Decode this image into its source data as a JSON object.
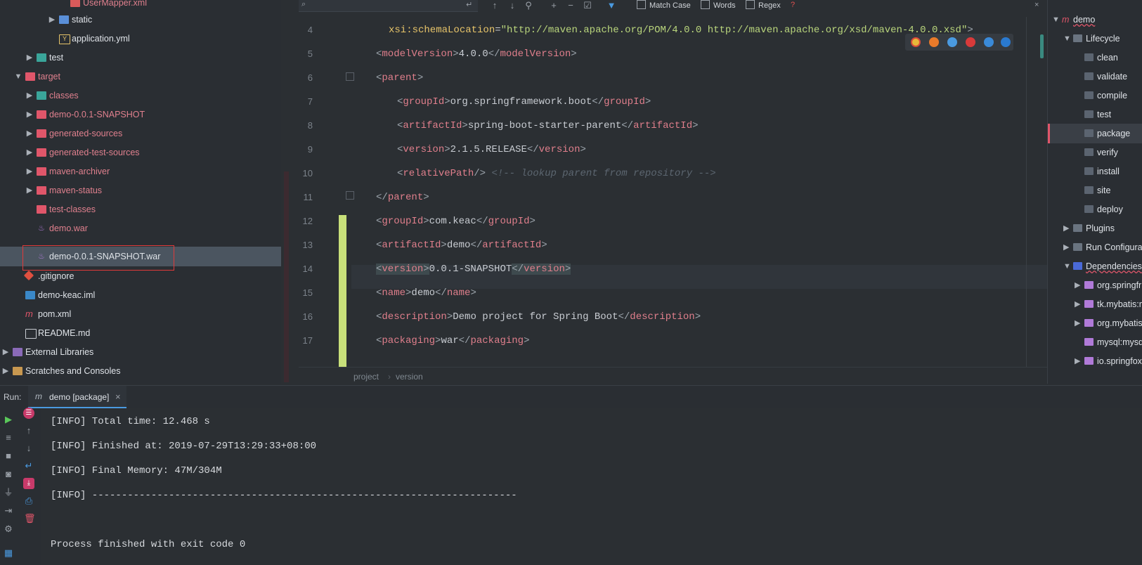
{
  "project_tree": {
    "items": [
      {
        "label": "UserMapper.xml",
        "kind": "xml"
      },
      {
        "label": "static",
        "kind": "folder"
      },
      {
        "label": "application.yml",
        "kind": "yml"
      },
      {
        "label": "test",
        "kind": "folder"
      },
      {
        "label": "target",
        "kind": "folder"
      },
      {
        "label": "classes",
        "kind": "folder"
      },
      {
        "label": "demo-0.0.1-SNAPSHOT",
        "kind": "folder"
      },
      {
        "label": "generated-sources",
        "kind": "folder"
      },
      {
        "label": "generated-test-sources",
        "kind": "folder"
      },
      {
        "label": "maven-archiver",
        "kind": "folder"
      },
      {
        "label": "maven-status",
        "kind": "folder"
      },
      {
        "label": "test-classes",
        "kind": "folder"
      },
      {
        "label": "demo.war",
        "kind": "war"
      },
      {
        "label": "demo-0.0.1-SNAPSHOT.war",
        "kind": "war"
      },
      {
        "label": ".gitignore",
        "kind": "git"
      },
      {
        "label": "demo-keac.iml",
        "kind": "iml"
      },
      {
        "label": "pom.xml",
        "kind": "maven"
      },
      {
        "label": "README.md",
        "kind": "md"
      },
      {
        "label": "External Libraries",
        "kind": "lib"
      },
      {
        "label": "Scratches and Consoles",
        "kind": "scratch"
      }
    ]
  },
  "search": {
    "match_case": "Match Case",
    "words": "Words",
    "regex": "Regex",
    "help": "?"
  },
  "editor": {
    "lines": [
      "4",
      "5",
      "6",
      "7",
      "8",
      "9",
      "10",
      "11",
      "12",
      "13",
      "14",
      "15",
      "16",
      "17"
    ],
    "code": {
      "l4_attr": "xsi:schemaLocation",
      "l4_val": "\"http://maven.apache.org/POM/4.0.0 http://maven.apache.org/xsd/maven-4.0.0.xsd\"",
      "l5": [
        "modelVersion",
        "4.0.0"
      ],
      "l6": "parent",
      "l7": [
        "groupId",
        "org.springframework.boot"
      ],
      "l8": [
        "artifactId",
        "spring-boot-starter-parent"
      ],
      "l9": [
        "version",
        "2.1.5.RELEASE"
      ],
      "l10_tag": "relativePath",
      "l10_cmt": "<!-- lookup parent from repository -->",
      "l11": "parent",
      "l12": [
        "groupId",
        "com.keac"
      ],
      "l13": [
        "artifactId",
        "demo"
      ],
      "l14": [
        "version",
        "0.0.1-SNAPSHOT"
      ],
      "l15": [
        "name",
        "demo"
      ],
      "l16": [
        "description",
        "Demo project for Spring Boot"
      ],
      "l17": [
        "packaging",
        "war"
      ]
    },
    "breadcrumb": [
      "project",
      "version"
    ]
  },
  "maven": {
    "root": "demo",
    "lifecycle": "Lifecycle",
    "goals": [
      "clean",
      "validate",
      "compile",
      "test",
      "package",
      "verify",
      "install",
      "site",
      "deploy"
    ],
    "plugins": "Plugins",
    "run_config": "Run Configura",
    "dependencies": "Dependencies",
    "deps": [
      "org.springfr",
      "tk.mybatis:m",
      "org.mybatis",
      "mysql:mysq",
      "io.springfox"
    ]
  },
  "run": {
    "label": "Run:",
    "tab": "demo [package]",
    "close": "×",
    "output": [
      "[INFO] Total time: 12.468 s",
      "[INFO] Finished at: 2019-07-29T13:29:33+08:00",
      "[INFO] Final Memory: 47M/304M",
      "[INFO] ------------------------------------------------------------------------",
      "",
      "Process finished with exit code 0"
    ]
  },
  "colors": {
    "accent": "#e0566a",
    "selection": "#4b5560",
    "highlight_box": "#e03a3a",
    "modified": "#c8e07a"
  }
}
